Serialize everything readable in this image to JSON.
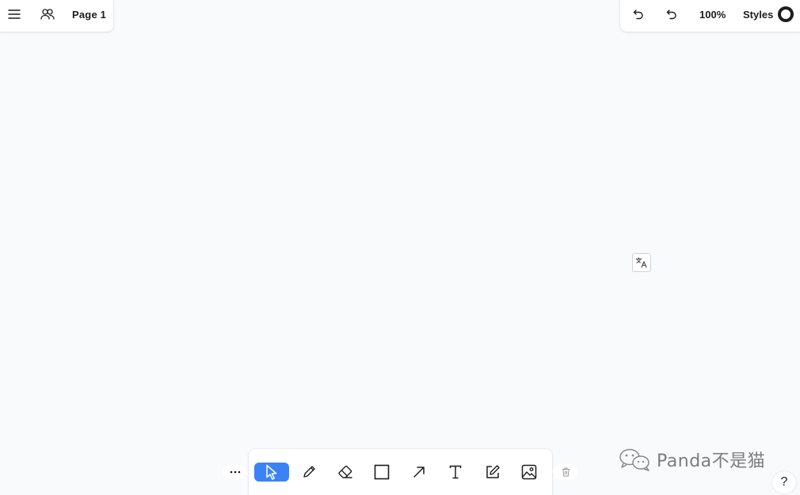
{
  "top_left": {
    "menu_icon": "hamburger-icon",
    "people_icon": "people-icon",
    "page_label": "Page 1"
  },
  "top_right": {
    "undo_icon": "undo-icon",
    "redo_icon": "redo-icon",
    "zoom": "100%",
    "styles_label": "Styles"
  },
  "translate": {
    "icon": "translate-icon"
  },
  "toolbar": {
    "more_icon": "ellipsis-icon",
    "tools": [
      {
        "name": "select",
        "icon": "cursor-icon",
        "active": true
      },
      {
        "name": "draw",
        "icon": "pencil-icon",
        "active": false
      },
      {
        "name": "eraser",
        "icon": "eraser-icon",
        "active": false
      },
      {
        "name": "rectangle",
        "icon": "square-icon",
        "active": false
      },
      {
        "name": "arrow",
        "icon": "arrow-icon",
        "active": false
      },
      {
        "name": "text",
        "icon": "text-icon",
        "active": false
      },
      {
        "name": "note",
        "icon": "note-icon",
        "active": false
      },
      {
        "name": "image",
        "icon": "image-icon",
        "active": false
      }
    ],
    "trash_icon": "trash-icon"
  },
  "watermark": {
    "text": "Panda不是猫",
    "icon": "wechat-icon"
  },
  "help": {
    "label": "?"
  },
  "colors": {
    "accent": "#3b82f6",
    "background": "#f9fafb",
    "panel": "#ffffff",
    "text": "#1d1d1d"
  }
}
